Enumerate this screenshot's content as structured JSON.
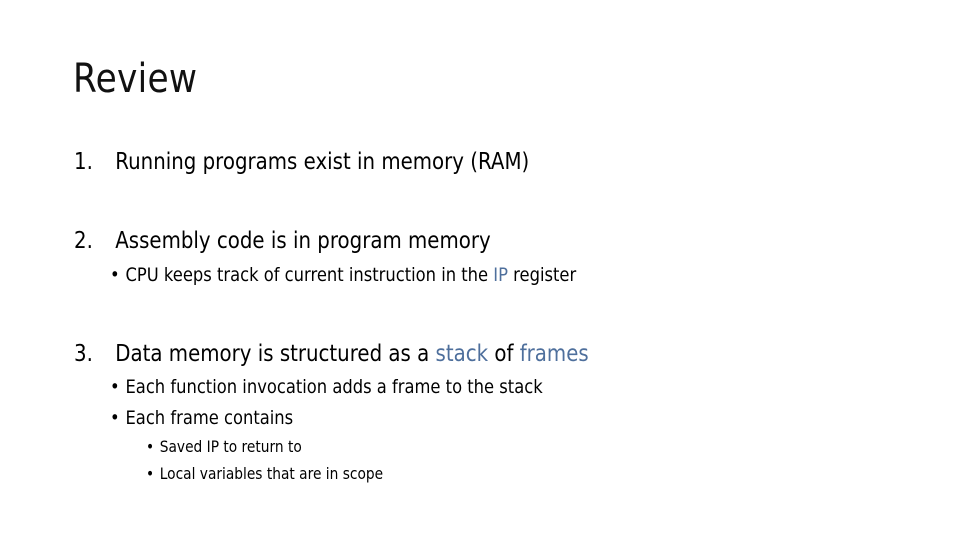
{
  "slide": {
    "title": "Review",
    "items": [
      {
        "number": "1.",
        "text": "Running programs exist in memory (RAM)"
      },
      {
        "number": "2.",
        "text": "Assembly code is in program memory",
        "sub": [
          {
            "before": "CPU keeps track of current instruction in the ",
            "highlight": "IP",
            "after": " register"
          }
        ]
      },
      {
        "number": "3.",
        "before": "Data memory is structured as a ",
        "highlight1": "stack",
        "middle": " of ",
        "highlight2": "frames",
        "sub": [
          {
            "text": "Each function invocation adds a frame to the stack"
          },
          {
            "text": "Each frame contains",
            "sub": [
              {
                "text": "Saved IP to return to"
              },
              {
                "text": "Local variables that are in scope"
              }
            ]
          }
        ]
      }
    ],
    "bullet": "•",
    "highlight_color": "#4e6f9c"
  }
}
